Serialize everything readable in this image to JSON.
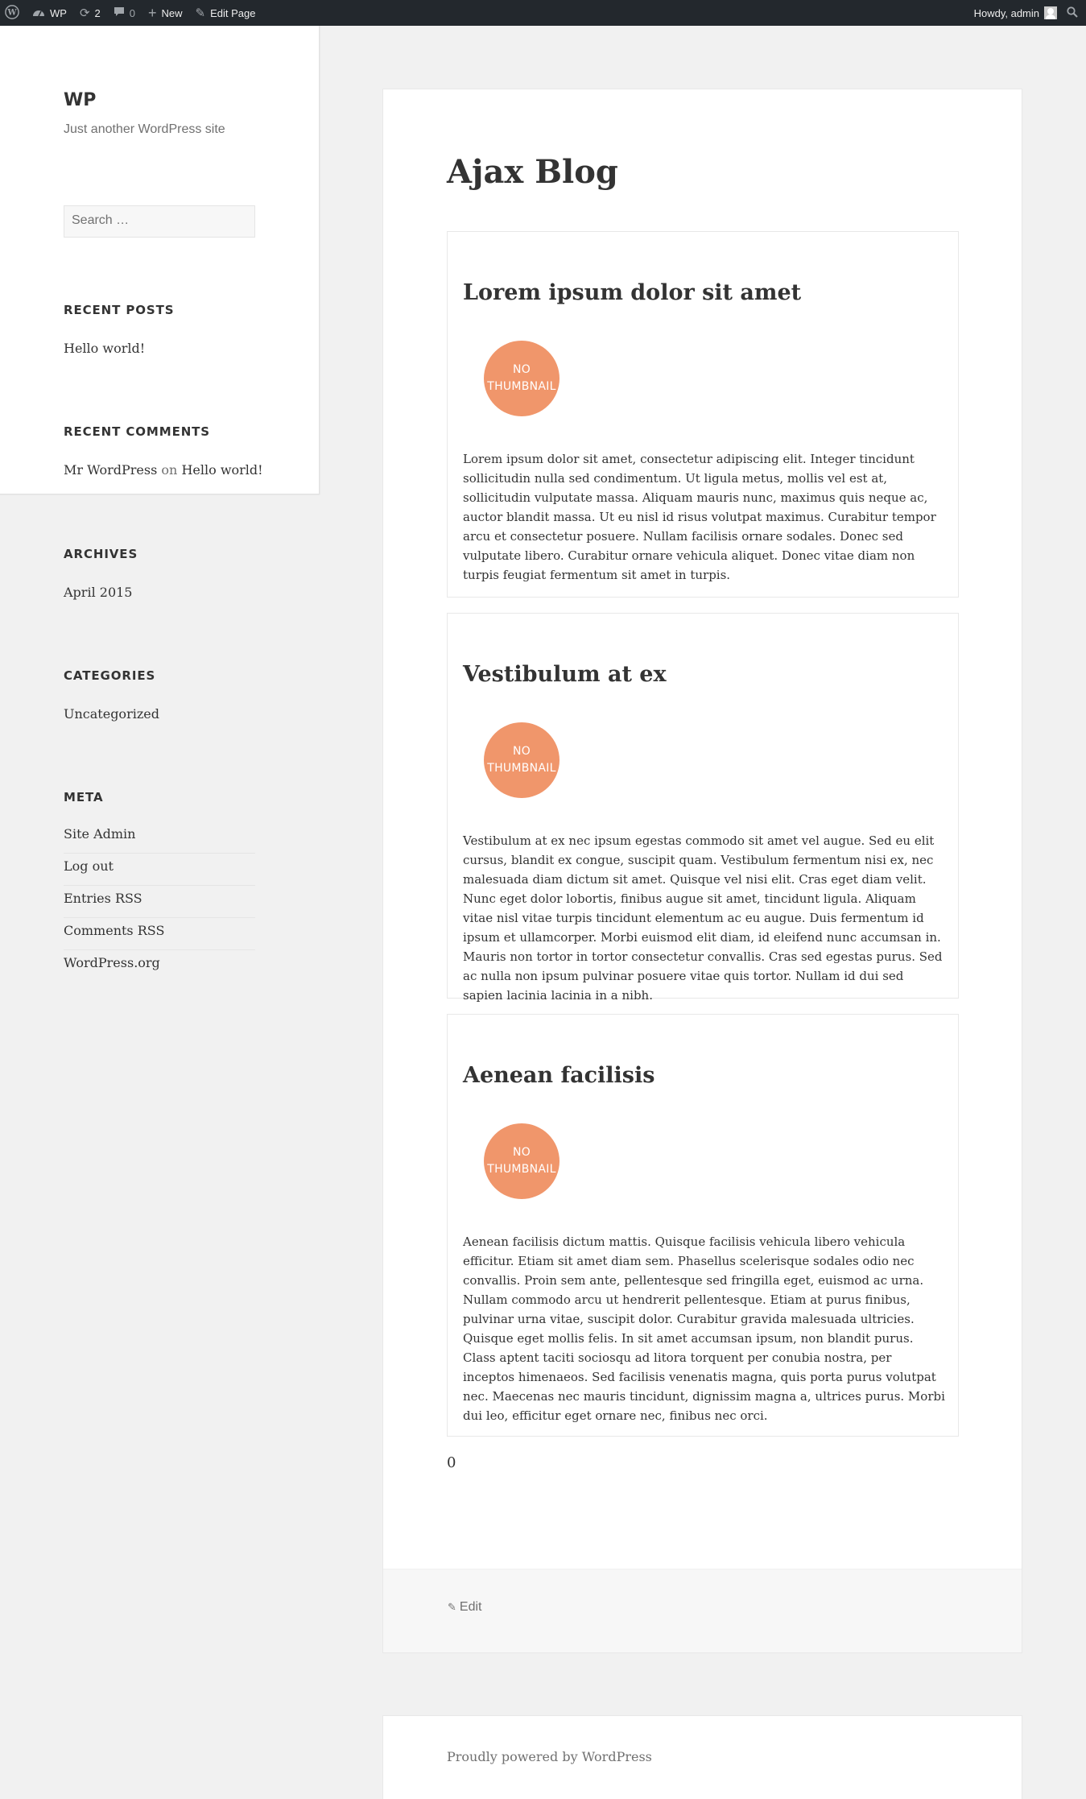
{
  "adminbar": {
    "site_name": "WP",
    "updates_count": "2",
    "comments_count": "0",
    "new_label": "New",
    "edit_page_label": "Edit Page",
    "howdy": "Howdy, admin"
  },
  "sidebar": {
    "site_title": "WP",
    "site_description": "Just another WordPress site",
    "search_placeholder": "Search …",
    "recent_posts": {
      "title": "RECENT POSTS",
      "items": [
        "Hello world!"
      ]
    },
    "recent_comments": {
      "title": "RECENT COMMENTS",
      "author": "Mr WordPress",
      "on": "on",
      "post": "Hello world!"
    },
    "archives": {
      "title": "ARCHIVES",
      "items": [
        "April 2015"
      ]
    },
    "categories": {
      "title": "CATEGORIES",
      "items": [
        "Uncategorized"
      ]
    },
    "meta": {
      "title": "META",
      "items": [
        "Site Admin",
        "Log out",
        "Entries RSS",
        "Comments RSS",
        "WordPress.org"
      ]
    }
  },
  "main": {
    "page_title": "Ajax Blog",
    "posts": [
      {
        "title": "Lorem ipsum dolor sit amet",
        "thumb_line1": "NO",
        "thumb_line2": "THUMBNAIL",
        "excerpt": "Lorem ipsum dolor sit amet, consectetur adipiscing elit. Integer tincidunt sollicitudin nulla sed condimentum. Ut ligula metus, mollis vel est at, sollicitudin vulputate massa. Aliquam mauris nunc, maximus quis neque ac, auctor blandit massa. Ut eu nisl id risus volutpat maximus. Curabitur tempor arcu et consectetur posuere. Nullam facilisis ornare sodales. Donec sed vulputate libero. Curabitur ornare vehicula aliquet. Donec vitae diam non turpis feugiat fermentum sit amet in turpis."
      },
      {
        "title": "Vestibulum at ex",
        "thumb_line1": "NO",
        "thumb_line2": "THUMBNAIL",
        "excerpt": "Vestibulum at ex nec ipsum egestas commodo sit amet vel augue. Sed eu elit cursus, blandit ex congue, suscipit quam. Vestibulum fermentum nisi ex, nec malesuada diam dictum sit amet. Quisque vel nisi elit. Cras eget diam velit. Nunc eget dolor lobortis, finibus augue sit amet, tincidunt ligula. Aliquam vitae nisl vitae turpis tincidunt elementum ac eu augue. Duis fermentum id ipsum et ullamcorper. Morbi euismod elit diam, id eleifend nunc accumsan in. Mauris non tortor in tortor consectetur convallis. Cras sed egestas purus. Sed ac nulla non ipsum pulvinar posuere vitae quis tortor. Nullam id dui sed sapien lacinia lacinia in a nibh."
      },
      {
        "title": "Aenean facilisis",
        "thumb_line1": "NO",
        "thumb_line2": "THUMBNAIL",
        "excerpt": "Aenean facilisis dictum mattis. Quisque facilisis vehicula libero vehicula efficitur. Etiam sit amet diam sem. Phasellus scelerisque sodales odio nec convallis. Proin sem ante, pellentesque sed fringilla eget, euismod ac urna. Nullam commodo arcu ut hendrerit pellentesque. Etiam at purus finibus, pulvinar urna vitae, suscipit dolor. Curabitur gravida malesuada ultricies. Quisque eget mollis felis. In sit amet accumsan ipsum, non blandit purus. Class aptent taciti sociosqu ad litora torquent per conubia nostra, per inceptos himenaeos. Sed facilisis venenatis magna, quis porta purus volutpat nec. Maecenas nec mauris tincidunt, dignissim magna a, ultrices purus. Morbi dui leo, efficitur eget ornare nec, finibus nec orci."
      }
    ],
    "counter": "0",
    "edit_label": "Edit"
  },
  "footer": {
    "powered_by": "Proudly powered by WordPress"
  }
}
